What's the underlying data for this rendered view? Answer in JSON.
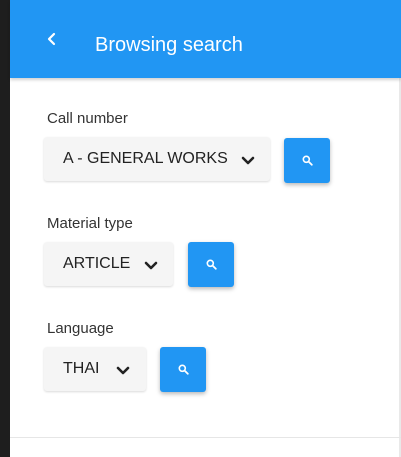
{
  "header": {
    "title": "Browsing search",
    "back_icon": "chevron-left-icon",
    "background_color": "#2196f3"
  },
  "call_number": {
    "label": "Call number",
    "selected": "A - GENERAL WORKS",
    "button_icon": "search-icon"
  },
  "material_type": {
    "label": "Material type",
    "selected": "ARTICLE",
    "button_icon": "search-icon"
  },
  "language": {
    "label": "Language",
    "selected": "THAI",
    "button_icon": "search-icon"
  },
  "accent_color": "#2196f3"
}
